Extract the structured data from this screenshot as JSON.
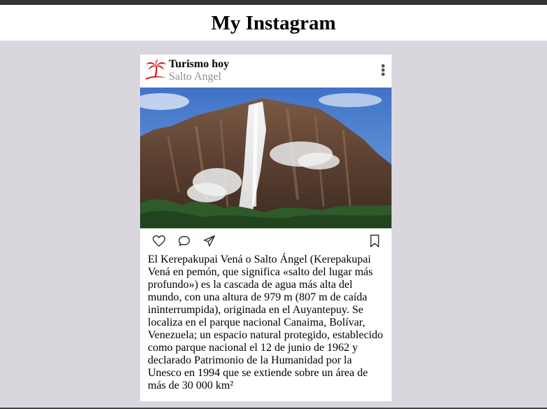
{
  "header": {
    "title": "My Instagram"
  },
  "post": {
    "account_name": "Turismo hoy",
    "location": "Salto Angel",
    "icons": {
      "logo": "palm-tree-logo-icon",
      "more": "more-vertical-icon",
      "like": "heart-icon",
      "comment": "comment-icon",
      "share": "send-icon",
      "save": "bookmark-icon"
    },
    "caption": "El Kerepakupai Vená o Salto Ángel (Kerepakupai Vená en pemón, que significa «salto del lugar más profundo») es la cascada de agua más alta del mundo, con una altura de 979 m (807 m de caída ininterrumpida), originada en el Auyantepuy. Se localiza en el parque nacional Canaima, Bolívar, Venezuela; un espacio natural protegido, establecido como parque nacional el 12 de junio de 1962 y declarado Patrimonio de la Humanidad por la Unesco en 1994 que se extiende sobre un área de más de 30 000 km²"
  },
  "colors": {
    "page_background": "#d9d6dd",
    "top_bar": "#333333",
    "logo_red": "#d8191f",
    "secondary_text": "#8e8e8e"
  }
}
